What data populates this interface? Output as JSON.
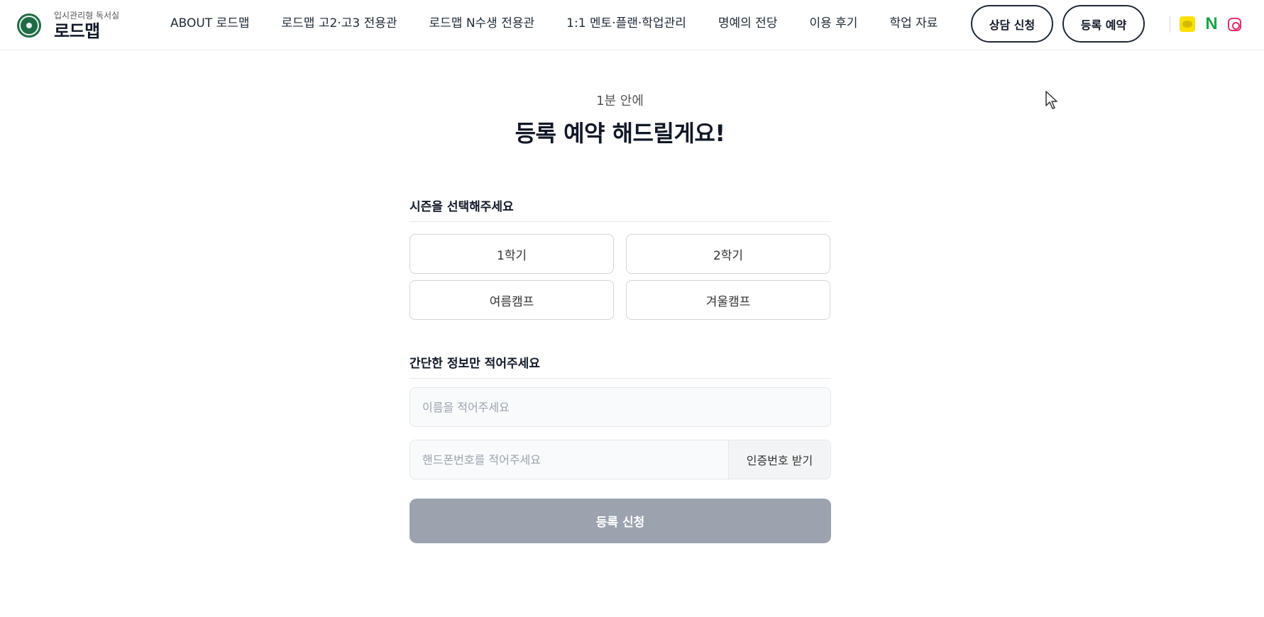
{
  "header": {
    "logo": {
      "sub": "입시관리형 독서실",
      "main": "로드맵"
    },
    "nav": [
      {
        "label": "ABOUT 로드맵"
      },
      {
        "label": "로드맵 고2·고3 전용관"
      },
      {
        "label": "로드맵 N수생 전용관"
      },
      {
        "label": "1:1 멘토·플랜·학업관리"
      },
      {
        "label": "명예의 전당"
      },
      {
        "label": "이용 후기"
      },
      {
        "label": "학업 자료"
      }
    ],
    "consult_label": "상담 신청",
    "reserve_label": "등록 예약",
    "socials": [
      "kakao-icon",
      "naver-icon",
      "instagram-icon"
    ]
  },
  "hero": {
    "eyebrow": "1분 안에",
    "headline": "등록 예약 해드릴게요!"
  },
  "season": {
    "label": "시즌을 선택해주세요",
    "options": [
      "1학기",
      "2학기",
      "여름캠프",
      "겨울캠프"
    ]
  },
  "info": {
    "label": "간단한 정보만 적어주세요",
    "name_placeholder": "이름을 적어주세요",
    "phone_placeholder": "핸드폰번호를 적어주세요",
    "verify_label": "인증번호 받기"
  },
  "submit_label": "등록 신청",
  "colors": {
    "brand_green": "#1f6b45",
    "submit_disabled": "#9ca3af",
    "kakao": "#fae100",
    "naver": "#19a54a",
    "instagram": "#e1306c"
  }
}
